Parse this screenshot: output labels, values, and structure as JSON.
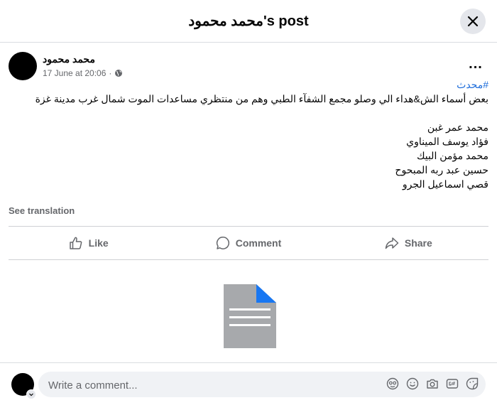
{
  "header": {
    "title": "محمد محمود's post"
  },
  "post": {
    "author": "محمد محمود",
    "timestamp": "17 June at 20:06",
    "separator": "·",
    "privacy_icon": "globe-icon",
    "more_label": "...",
    "hashtag": "#محدث",
    "lines": [
      "بعض أسماء الش&هداء الي وصلو مجمع الشفآء الطبي وهم من منتظري مساعدات الموت شمال غرب مدينة غزة",
      "",
      "محمد عمر غبن",
      "فؤاد يوسف الميناوي",
      "محمد مؤمن البيك",
      "حسين عبد ربه المبحوح",
      "قصي اسماعيل الجرو"
    ],
    "see_translation": "See translation"
  },
  "actions": {
    "like": "Like",
    "comment": "Comment",
    "share": "Share"
  },
  "attachment": {
    "icon": "document-icon"
  },
  "composer": {
    "placeholder": "Write a comment...",
    "icons": [
      "avatar-sticker-icon",
      "emoji-icon",
      "camera-icon",
      "gif-icon",
      "sticker-icon"
    ]
  },
  "colors": {
    "accent": "#216fdb",
    "muted": "#65676b",
    "doc_gray": "#a7a9ac",
    "doc_fold": "#1877f2"
  }
}
